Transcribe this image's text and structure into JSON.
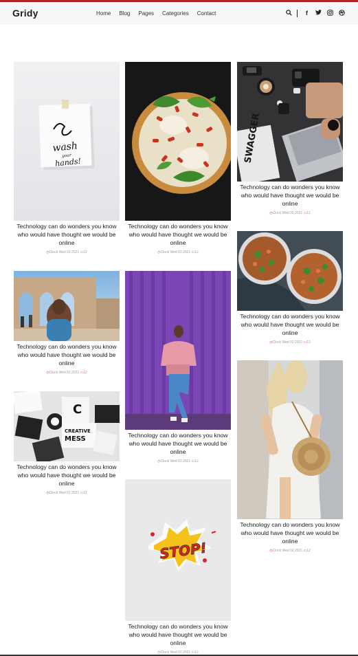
{
  "header": {
    "logo": "Gridy",
    "nav": [
      "Home",
      "Blog",
      "Pages",
      "Categories",
      "Contact"
    ],
    "icons": [
      "search-icon",
      "facebook-icon",
      "twitter-icon",
      "instagram-icon",
      "dribbble-icon"
    ],
    "accent": "#b41f24"
  },
  "posts": [
    {
      "title": "Technology can do wonders you know who would have thought we would be online",
      "meta": "Clock Wed 02,2021",
      "comments": "12",
      "image": "wash-your-hands-note"
    },
    {
      "title": "Technology can do wonders you know who would have thought we would be online",
      "meta": "Clock Wed 02,2021",
      "comments": "12",
      "image": "pizza"
    },
    {
      "title": "Technology can do wonders you know who would have thought we would be online",
      "meta": "Clock Wed 02,2021",
      "comments": "12",
      "image": "desk-laptop-coffee"
    },
    {
      "title": "Technology can do wonders you know who would have thought we would be online",
      "meta": "Clock Wed 02,2021",
      "comments": "12",
      "image": "woman-ancient-ruins"
    },
    {
      "title": "Technology can do wonders you know who would have thought we would be online",
      "meta": "Clock Wed 02,2021",
      "comments": "12",
      "image": "woman-purple-wall"
    },
    {
      "title": "Technology can do wonders you know who would have thought we would be online",
      "meta": "Clock Wed 02,2021",
      "comments": "12",
      "image": "food-bowls"
    },
    {
      "title": "Technology can do wonders you know who would have thought we would be online",
      "meta": "Clock Wed 02,2021",
      "comments": "12",
      "image": "creative-mess-signs"
    },
    {
      "title": "Technology can do wonders you know who would have thought we would be online",
      "meta": "Clock Wed 02,2021",
      "comments": "12",
      "image": "stop-sticker"
    },
    {
      "title": "Technology can do wonders you know who would have thought we would be online",
      "meta": "Clock Wed 02,2021",
      "comments": "12",
      "image": "woman-straw-bag"
    }
  ],
  "image_text": {
    "note_line1": "wash",
    "note_line2": "your",
    "note_line3": "hands!",
    "mag": "SWAGGER",
    "sign1": "C",
    "sign2": "CREATIVE",
    "sign3": "MESS",
    "stop": "STOP!"
  }
}
